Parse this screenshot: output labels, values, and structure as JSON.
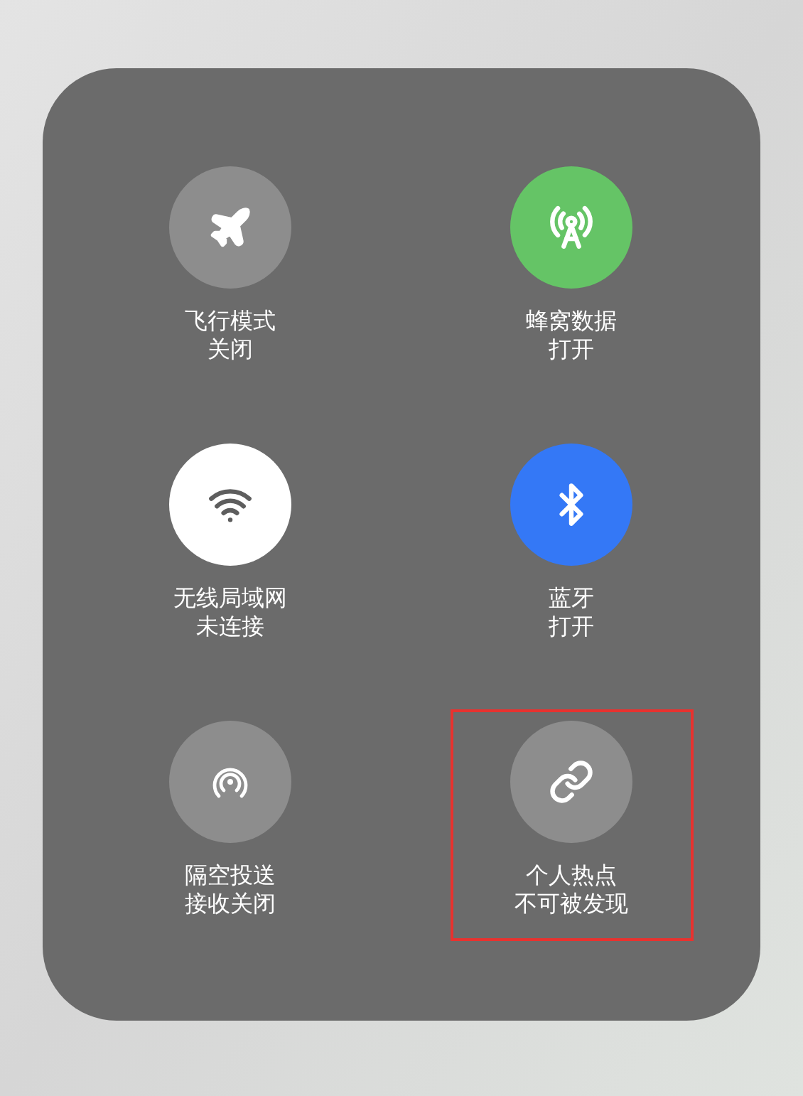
{
  "toggles": [
    {
      "kind": "airplane",
      "label": "飞行模式",
      "status": "关闭",
      "on": false,
      "highlighted": false
    },
    {
      "kind": "cellular",
      "label": "蜂窝数据",
      "status": "打开",
      "on": true,
      "highlighted": false
    },
    {
      "kind": "wifi",
      "label": "无线局域网",
      "status": "未连接",
      "on": true,
      "highlighted": false
    },
    {
      "kind": "bluetooth",
      "label": "蓝牙",
      "status": "打开",
      "on": true,
      "highlighted": false
    },
    {
      "kind": "airdrop",
      "label": "隔空投送",
      "status": "接收关闭",
      "on": false,
      "highlighted": false
    },
    {
      "kind": "hotspot",
      "label": "个人热点",
      "status": "不可被发现",
      "on": false,
      "highlighted": true
    }
  ]
}
